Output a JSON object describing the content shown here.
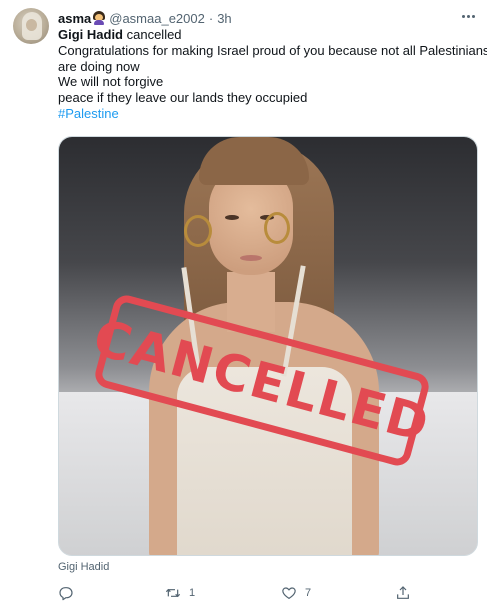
{
  "tweet": {
    "name": "asma",
    "handle": "@asmaa_e2002",
    "dot": "·",
    "time": "3h",
    "lines": {
      "l1_bold": "Gigi Hadid",
      "l1_rest": " cancelled",
      "l2": "Congratulations for making Israel proud of you because not all Palestinians",
      "l3": "are doing now",
      "l4": "We will not forgive",
      "l5": "peace if they leave our lands they occupied",
      "hashtag": "#Palestine"
    },
    "media": {
      "stamp_text": "CANCELLED",
      "caption": "Gigi Hadid"
    },
    "actions": {
      "reply_count": "",
      "retweet_count": "1",
      "like_count": "7"
    }
  },
  "icons": {
    "more": "more-dots-icon",
    "reply": "reply-icon",
    "retweet": "retweet-icon",
    "like": "heart-icon",
    "share": "share-icon"
  },
  "colors": {
    "link": "#1d9bf0",
    "secondary_text": "#536471",
    "stamp": "#e24a52"
  }
}
